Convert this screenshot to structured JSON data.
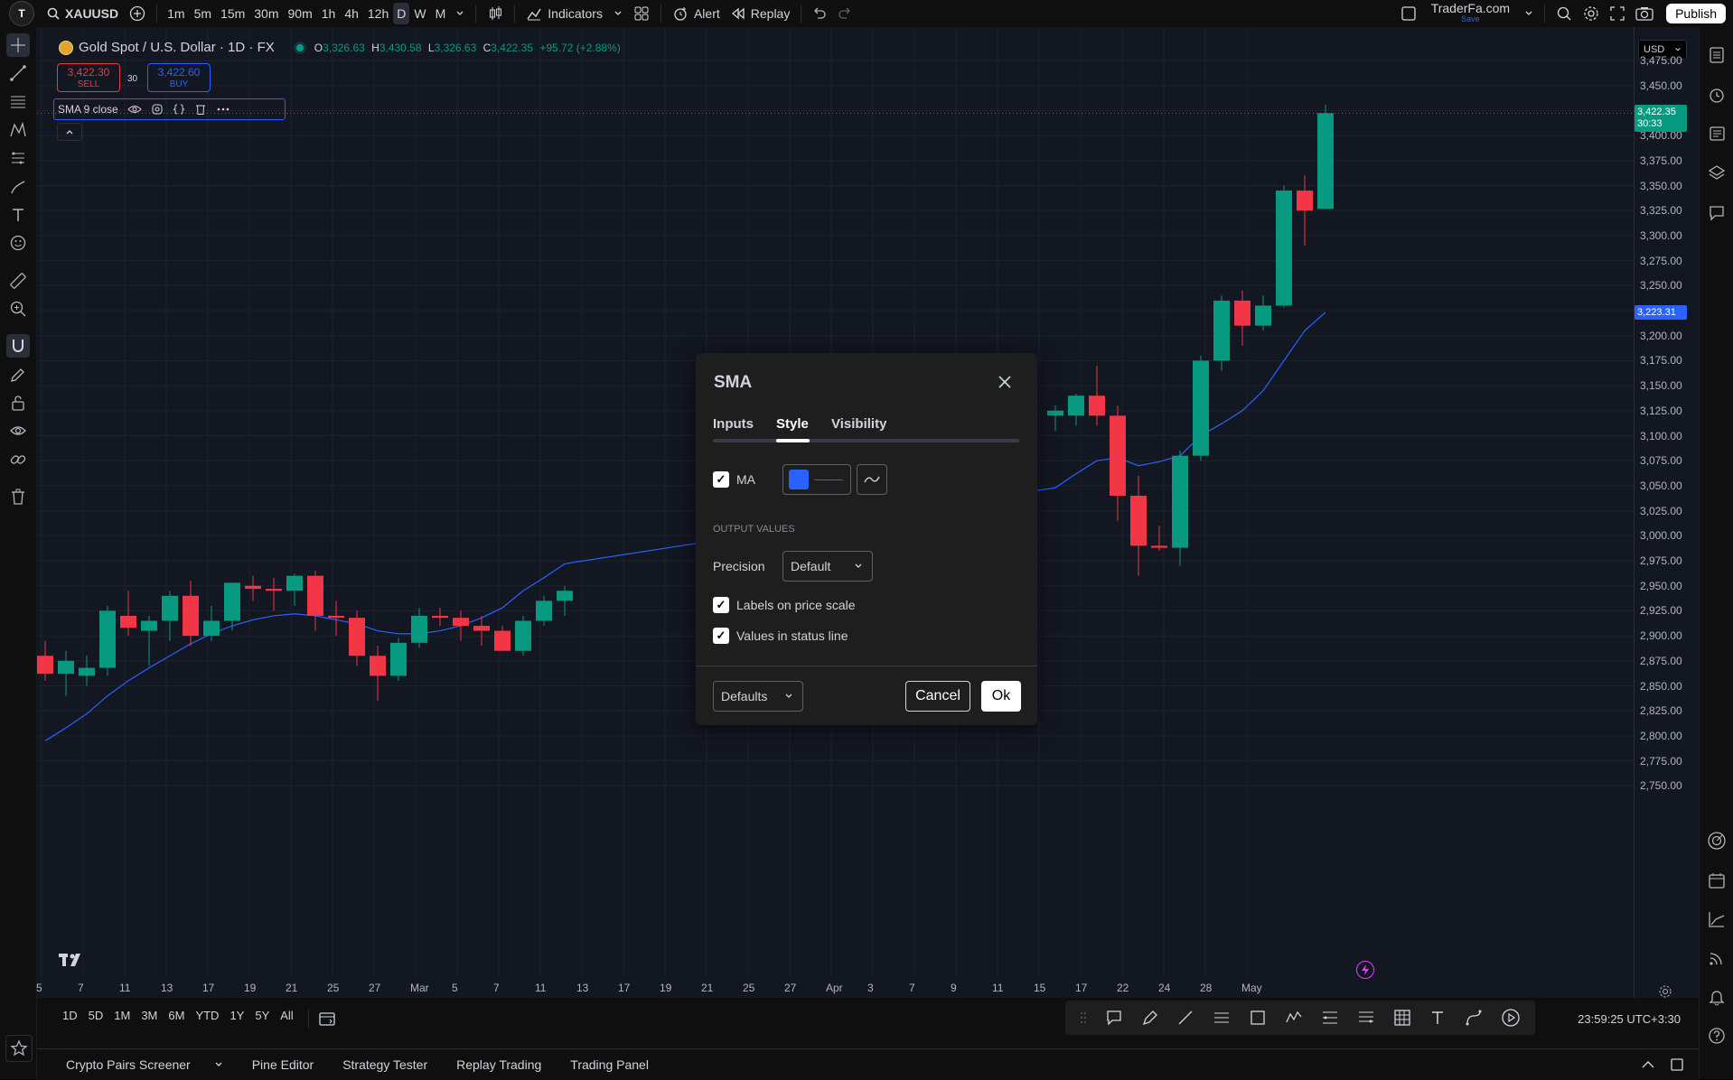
{
  "topbar": {
    "symbol": "XAUUSD",
    "intervals": [
      "1m",
      "5m",
      "15m",
      "30m",
      "90m",
      "1h",
      "4h",
      "12h",
      "D",
      "W",
      "M"
    ],
    "active_interval": "D",
    "indicators_label": "Indicators",
    "alert_label": "Alert",
    "replay_label": "Replay",
    "brand": "TraderFa.com",
    "brand_sub": "Save",
    "publish_label": "Publish",
    "logo_text": "T"
  },
  "legend": {
    "title": "Gold Spot / U.S. Dollar · 1D · FX",
    "o_label": "O",
    "o": "3,326.63",
    "h_label": "H",
    "h": "3,430.58",
    "l_label": "L",
    "l": "3,326.63",
    "c_label": "C",
    "c": "3,422.35",
    "change": "+95.72 (+2.88%)",
    "sell_price": "3,422.30",
    "sell_label": "SELL",
    "spread": "30",
    "buy_price": "3,422.60",
    "buy_label": "BUY",
    "indicator": "SMA 9 close"
  },
  "price_scale": {
    "currency": "USD",
    "ticks": [
      "3,475.00",
      "3,450.00",
      "3,425.00",
      "3,400.00",
      "3,375.00",
      "3,350.00",
      "3,325.00",
      "3,300.00",
      "3,275.00",
      "3,250.00",
      "3,225.00",
      "3,200.00",
      "3,175.00",
      "3,150.00",
      "3,125.00",
      "3,100.00",
      "3,075.00",
      "3,050.00",
      "3,025.00",
      "3,000.00",
      "2,975.00",
      "2,950.00",
      "2,925.00",
      "2,900.00",
      "2,875.00",
      "2,850.00",
      "2,825.00",
      "2,800.00",
      "2,775.00",
      "2,750.00"
    ],
    "last_price": "3,422.35",
    "countdown": "30:33",
    "sma_price": "3,223.31",
    "sma_value": 3223.31,
    "last_value": 3422.35
  },
  "time_axis": [
    "5",
    "7",
    "11",
    "13",
    "17",
    "19",
    "21",
    "25",
    "27",
    "Mar",
    "5",
    "7",
    "11",
    "13",
    "17",
    "19",
    "21",
    "25",
    "27",
    "Apr",
    "3",
    "7",
    "9",
    "11",
    "15",
    "17",
    "22",
    "24",
    "28",
    "May"
  ],
  "bottom": {
    "ranges": [
      "1D",
      "5D",
      "1M",
      "3M",
      "6M",
      "YTD",
      "1Y",
      "5Y",
      "All"
    ],
    "clock": "23:59:25 UTC+3:30"
  },
  "tabs": [
    "Crypto Pairs Screener",
    "Pine Editor",
    "Strategy Tester",
    "Replay Trading",
    "Trading Panel"
  ],
  "dialog": {
    "title": "SMA",
    "tabs": [
      "Inputs",
      "Style",
      "Visibility"
    ],
    "active_tab": "Style",
    "ma_label": "MA",
    "ma_color": "#2962ff",
    "output_values": "OUTPUT VALUES",
    "precision_label": "Precision",
    "precision_value": "Default",
    "labels_on_scale": "Labels on price scale",
    "values_in_status": "Values in status line",
    "defaults_label": "Defaults",
    "cancel_label": "Cancel",
    "ok_label": "Ok"
  },
  "chart_data": {
    "type": "candlestick",
    "up_color": "#089981",
    "down_color": "#f23645",
    "sma_color": "#2962ff",
    "ylim": [
      2750,
      3475
    ],
    "candles": [
      [
        2880,
        2895,
        2855,
        2862
      ],
      [
        2862,
        2885,
        2840,
        2875
      ],
      [
        2860,
        2880,
        2850,
        2868
      ],
      [
        2868,
        2930,
        2860,
        2925
      ],
      [
        2920,
        2945,
        2900,
        2908
      ],
      [
        2905,
        2920,
        2870,
        2915
      ],
      [
        2915,
        2945,
        2895,
        2940
      ],
      [
        2940,
        2955,
        2890,
        2900
      ],
      [
        2900,
        2930,
        2895,
        2915
      ],
      [
        2915,
        2950,
        2905,
        2953
      ],
      [
        2950,
        2960,
        2935,
        2947
      ],
      [
        2947,
        2958,
        2925,
        2945
      ],
      [
        2945,
        2962,
        2930,
        2960
      ],
      [
        2960,
        2965,
        2905,
        2920
      ],
      [
        2920,
        2935,
        2900,
        2918
      ],
      [
        2918,
        2925,
        2870,
        2880
      ],
      [
        2880,
        2890,
        2835,
        2860
      ],
      [
        2860,
        2898,
        2855,
        2893
      ],
      [
        2893,
        2928,
        2888,
        2920
      ],
      [
        2920,
        2928,
        2910,
        2918
      ],
      [
        2918,
        2925,
        2895,
        2910
      ],
      [
        2910,
        2920,
        2890,
        2905
      ],
      [
        2905,
        2910,
        2885,
        2885
      ],
      [
        2885,
        2920,
        2880,
        2915
      ],
      [
        2915,
        2940,
        2910,
        2935
      ],
      [
        2935,
        2950,
        2920,
        2945
      ],
      [
        3120,
        3130,
        3105,
        3125
      ],
      [
        3120,
        3142,
        3110,
        3140
      ],
      [
        3140,
        3170,
        3110,
        3120
      ],
      [
        3120,
        3130,
        3015,
        3040
      ],
      [
        3040,
        3060,
        2960,
        2990
      ],
      [
        2990,
        3010,
        2985,
        2988
      ],
      [
        2988,
        3085,
        2970,
        3080
      ],
      [
        3080,
        3180,
        3075,
        3175
      ],
      [
        3175,
        3240,
        3165,
        3235
      ],
      [
        3235,
        3245,
        3190,
        3210
      ],
      [
        3210,
        3240,
        3205,
        3230
      ],
      [
        3230,
        3350,
        3228,
        3345
      ],
      [
        3345,
        3360,
        3290,
        3325
      ],
      [
        3326.63,
        3430.58,
        3326.63,
        3422.35
      ]
    ],
    "sma": [
      2795,
      2808,
      2822,
      2840,
      2855,
      2868,
      2880,
      2892,
      2902,
      2910,
      2916,
      2920,
      2922,
      2920,
      2916,
      2912,
      2905,
      2902,
      2902,
      2905,
      2910,
      2918,
      2928,
      2945,
      2958,
      2972,
      3048,
      3062,
      3075,
      3078,
      3070,
      3074,
      3080,
      3100,
      3112,
      3125,
      3145,
      3175,
      3205,
      3223.31
    ]
  }
}
